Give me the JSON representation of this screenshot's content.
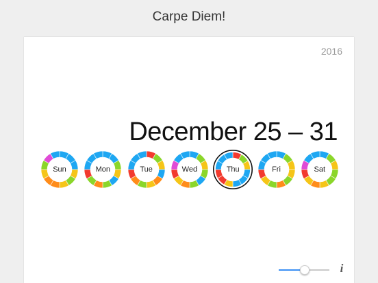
{
  "app": {
    "title": "Carpe Diem!"
  },
  "calendar": {
    "year": "2016",
    "date_range": "December 25 – 31",
    "selected_day": "Thu",
    "days": [
      {
        "label": "Sun",
        "segments": [
          "#1ea7f2",
          "#1ea7f2",
          "#1ea7f2",
          "#f5c518",
          "#8bd62a",
          "#f5c518",
          "#ff8c1a",
          "#ff8c1a",
          "#f5c518",
          "#8bd62a",
          "#e04bd6",
          "#1ea7f2"
        ]
      },
      {
        "label": "Mon",
        "segments": [
          "#1ea7f2",
          "#1ea7f2",
          "#8bd62a",
          "#f5c518",
          "#1ea7f2",
          "#8bd62a",
          "#ff8c1a",
          "#8bd62a",
          "#f23a2e",
          "#1ea7f2",
          "#1ea7f2",
          "#1ea7f2"
        ]
      },
      {
        "label": "Tue",
        "segments": [
          "#f23a2e",
          "#8bd62a",
          "#f5c518",
          "#1ea7f2",
          "#ff8c1a",
          "#f5c518",
          "#8bd62a",
          "#ff8c1a",
          "#f23a2e",
          "#1ea7f2",
          "#1ea7f2",
          "#1ea7f2"
        ]
      },
      {
        "label": "Wed",
        "segments": [
          "#1ea7f2",
          "#8bd62a",
          "#f5c518",
          "#8bd62a",
          "#1ea7f2",
          "#8bd62a",
          "#ff8c1a",
          "#f5c518",
          "#f23a2e",
          "#e04bd6",
          "#1ea7f2",
          "#1ea7f2"
        ]
      },
      {
        "label": "Thu",
        "segments": [
          "#f23a2e",
          "#8bd62a",
          "#f5c518",
          "#1ea7f2",
          "#1ea7f2",
          "#1ea7f2",
          "#f5c518",
          "#f23a2e",
          "#f23a2e",
          "#1ea7f2",
          "#1ea7f2",
          "#1ea7f2"
        ]
      },
      {
        "label": "Fri",
        "segments": [
          "#1ea7f2",
          "#8bd62a",
          "#f5c518",
          "#f5c518",
          "#8bd62a",
          "#ff8c1a",
          "#8bd62a",
          "#f5c518",
          "#f23a2e",
          "#1ea7f2",
          "#1ea7f2",
          "#1ea7f2"
        ]
      },
      {
        "label": "Sat",
        "segments": [
          "#1ea7f2",
          "#8bd62a",
          "#f5c518",
          "#8bd62a",
          "#8bd62a",
          "#f5c518",
          "#ff8c1a",
          "#f5c518",
          "#f23a2e",
          "#e04bd6",
          "#1ea7f2",
          "#1ea7f2"
        ]
      }
    ]
  },
  "controls": {
    "zoom_level": 0.5,
    "info_label": "i"
  },
  "colors": {
    "accent": "#3a8ff5",
    "ring_separator": "#ffffff",
    "selected_outline": "#111111"
  }
}
